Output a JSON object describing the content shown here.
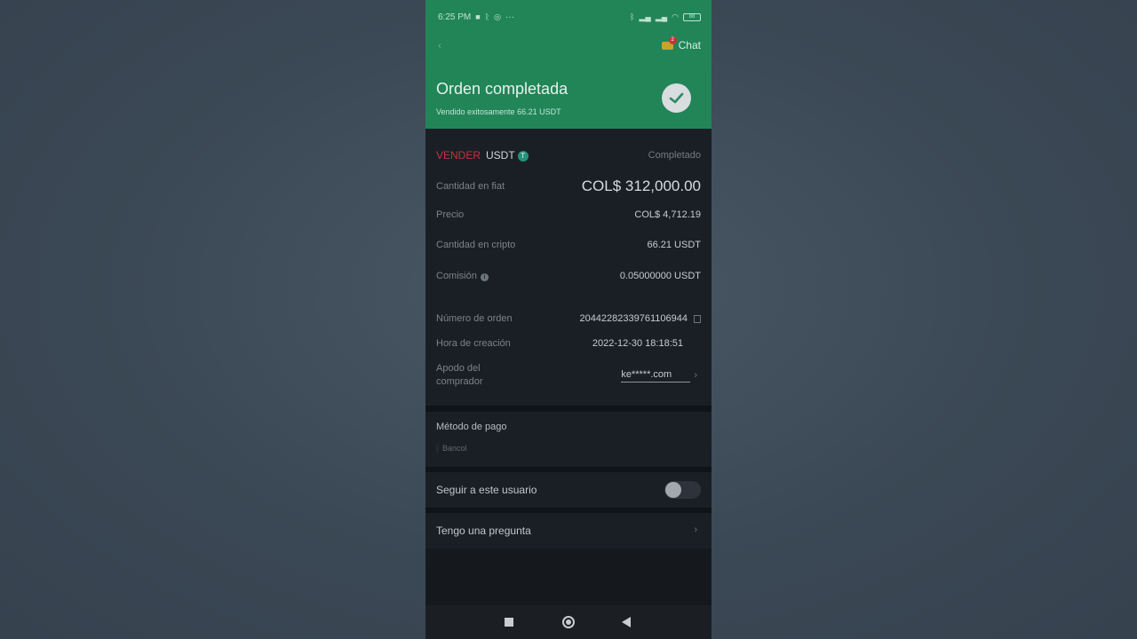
{
  "status_bar": {
    "time": "6:25 PM",
    "more": "···",
    "battery": "88"
  },
  "header": {
    "chat_label": "Chat",
    "chat_badge": "2",
    "title": "Orden completada",
    "subtitle": "Vendido exitosamente  66.21 USDT"
  },
  "order": {
    "side": "VENDER",
    "asset": "USDT",
    "asset_icon_letter": "T",
    "status": "Completado",
    "fiat_label": "Cantidad en fiat",
    "fiat_value": "COL$ 312,000.00",
    "price_label": "Precio",
    "price_value": "COL$ 4,712.19",
    "crypto_label": "Cantidad en cripto",
    "crypto_value": "66.21 USDT",
    "fee_label": "Comisión",
    "fee_value": "0.05000000 USDT",
    "order_number_label": "Número de orden",
    "order_number_value": "20442282339761106944",
    "created_label": "Hora de creación",
    "created_value": "2022-12-30 18:18:51",
    "buyer_label_line1": "Apodo del",
    "buyer_label_line2": "comprador",
    "buyer_value": "ke*****.com"
  },
  "payment": {
    "title": "Método de pago",
    "bank": "Bancol"
  },
  "follow": {
    "label": "Seguir a este usuario",
    "enabled": false
  },
  "question": {
    "label": "Tengo una pregunta"
  },
  "colors": {
    "header_green": "#218558",
    "sell_red": "#c8323e",
    "panel_bg": "#1a1f25"
  }
}
